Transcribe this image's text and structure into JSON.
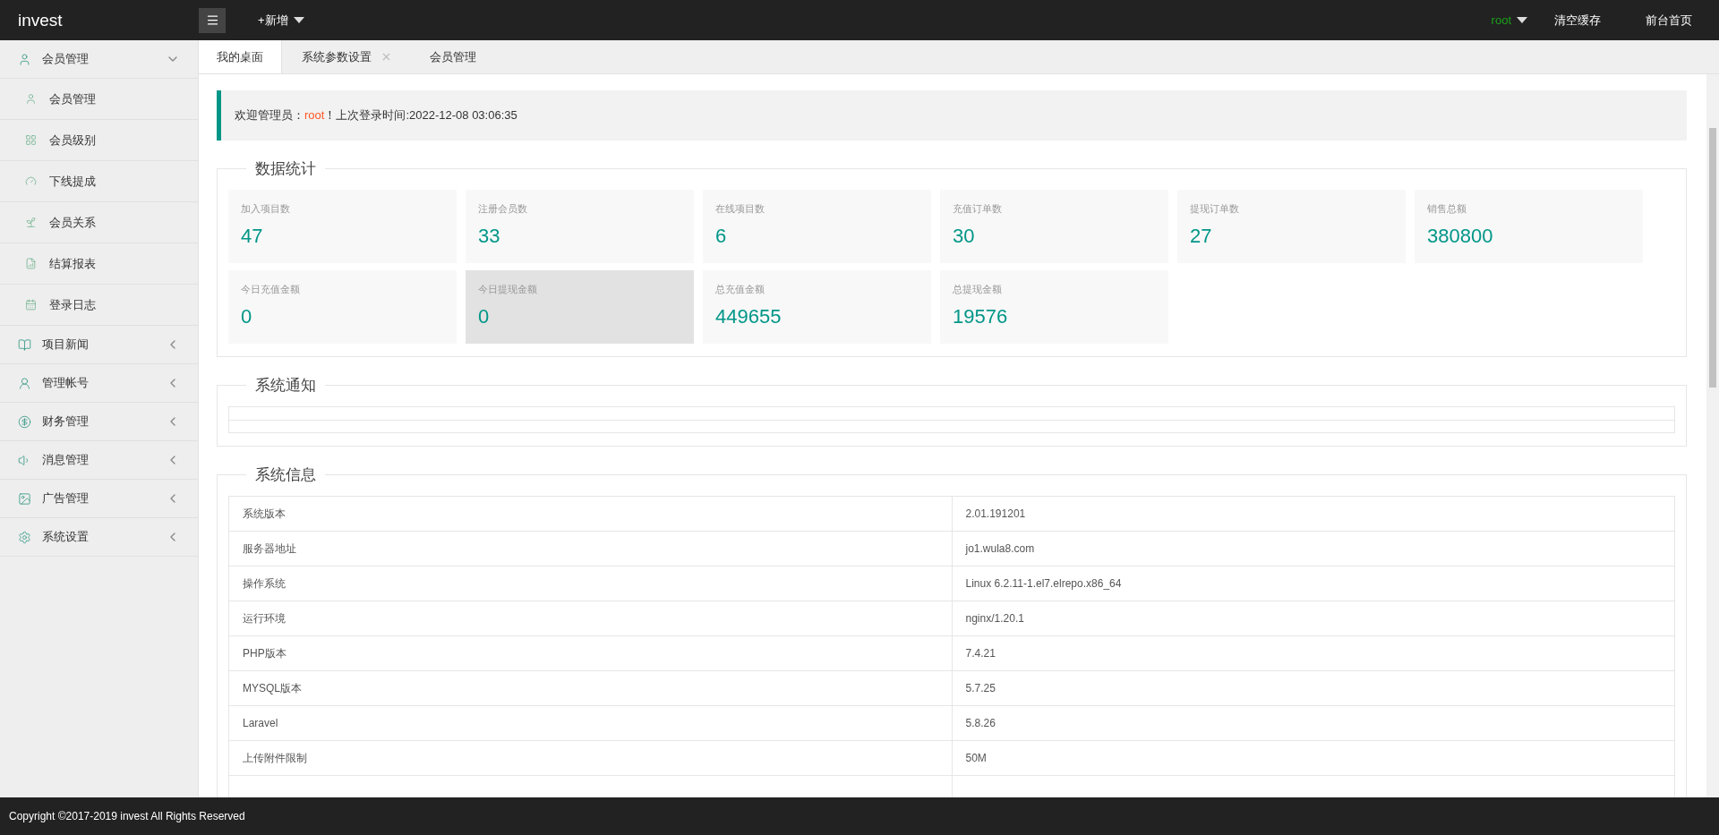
{
  "header": {
    "logo": "invest",
    "add_menu": "+新增",
    "user": "root",
    "links": [
      "清空缓存",
      "前台首页"
    ]
  },
  "sidebar": {
    "items": [
      {
        "label": "会员管理",
        "expanded": true,
        "children": [
          {
            "label": "会员管理"
          },
          {
            "label": "会员级别"
          },
          {
            "label": "下线提成"
          },
          {
            "label": "会员关系"
          },
          {
            "label": "结算报表"
          },
          {
            "label": "登录日志"
          }
        ]
      },
      {
        "label": "项目新闻",
        "expanded": false
      },
      {
        "label": "管理帐号",
        "expanded": false
      },
      {
        "label": "财务管理",
        "expanded": false
      },
      {
        "label": "消息管理",
        "expanded": false
      },
      {
        "label": "广告管理",
        "expanded": false
      },
      {
        "label": "系统设置",
        "expanded": false
      }
    ]
  },
  "tabs": [
    {
      "label": "我的桌面",
      "selected": true,
      "closable": false
    },
    {
      "label": "系统参数设置",
      "selected": false,
      "closable": true
    },
    {
      "label": "会员管理",
      "selected": false,
      "closable": false
    }
  ],
  "welcome": {
    "prefix": "欢迎管理员：",
    "user": "root",
    "suffix": "！上次登录时间:2022-12-08 03:06:35"
  },
  "stats": {
    "title": "数据统计",
    "cards": [
      {
        "label": "加入项目数",
        "value": "47",
        "highlighted": false
      },
      {
        "label": "注册会员数",
        "value": "33",
        "highlighted": false
      },
      {
        "label": "在线项目数",
        "value": "6",
        "highlighted": false
      },
      {
        "label": "充值订单数",
        "value": "30",
        "highlighted": false
      },
      {
        "label": "提现订单数",
        "value": "27",
        "highlighted": false
      },
      {
        "label": "销售总额",
        "value": "380800",
        "highlighted": false
      },
      {
        "label": "今日充值金额",
        "value": "0",
        "highlighted": false
      },
      {
        "label": "今日提现金额",
        "value": "0",
        "highlighted": true
      },
      {
        "label": "总充值金额",
        "value": "449655",
        "highlighted": false
      },
      {
        "label": "总提现金额",
        "value": "19576",
        "highlighted": false
      }
    ]
  },
  "notices": {
    "title": "系统通知"
  },
  "system_info": {
    "title": "系统信息",
    "rows": [
      [
        "系统版本",
        "2.01.191201"
      ],
      [
        "服务器地址",
        "jo1.wula8.com"
      ],
      [
        "操作系统",
        "Linux 6.2.11-1.el7.elrepo.x86_64"
      ],
      [
        "运行环境",
        "nginx/1.20.1"
      ],
      [
        "PHP版本",
        "7.4.21"
      ],
      [
        "MYSQL版本",
        "5.7.25"
      ],
      [
        "Laravel",
        "5.8.26"
      ],
      [
        "上传附件限制",
        "50M"
      ]
    ]
  },
  "footer": {
    "text": "Copyright ©2017-2019 invest All Rights Reserved"
  }
}
